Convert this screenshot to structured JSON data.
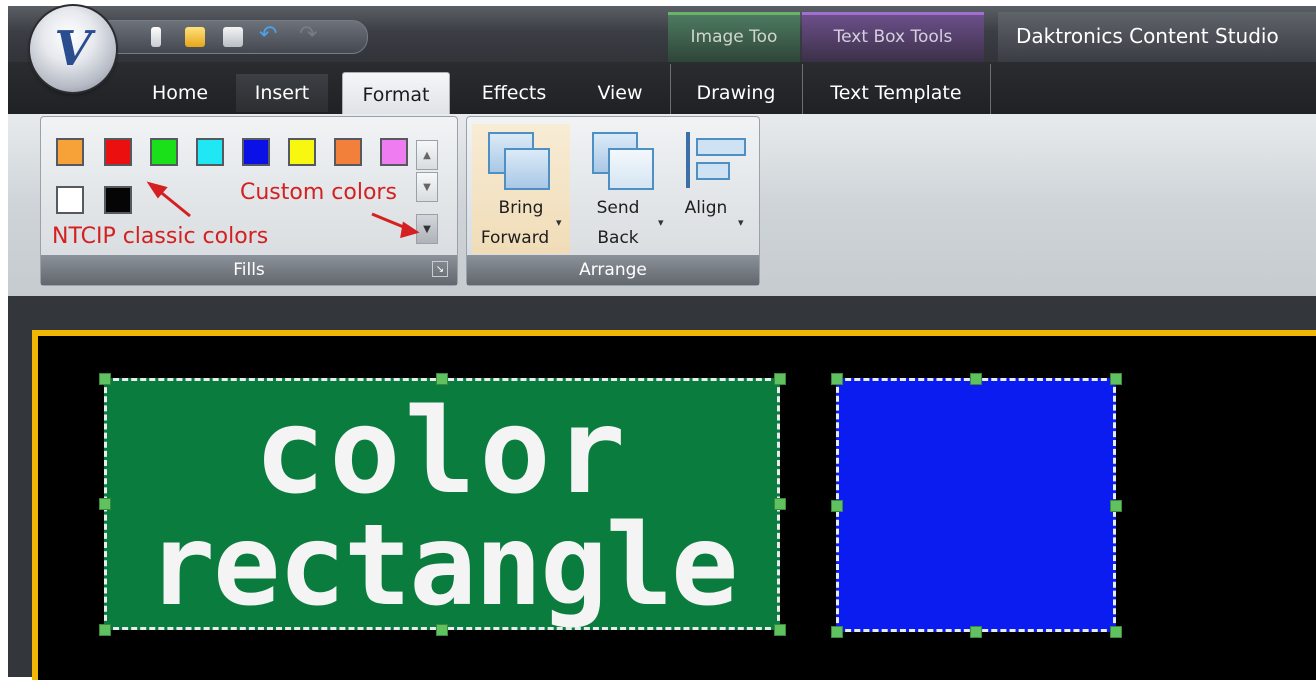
{
  "app": {
    "title": "Daktronics Content Studio",
    "logo_letter": "V",
    "contextual_tabs": [
      "Image Too",
      "Text Box Tools"
    ]
  },
  "quick_access": {
    "icons": [
      "new-document-icon",
      "open-folder-icon",
      "save-icon",
      "undo-icon",
      "redo-icon"
    ]
  },
  "tabs": [
    {
      "label": "Home"
    },
    {
      "label": "Insert"
    },
    {
      "label": "Format",
      "active": true
    },
    {
      "label": "Effects"
    },
    {
      "label": "View"
    },
    {
      "label": "Drawing"
    },
    {
      "label": "Text Template"
    }
  ],
  "fills": {
    "group_label": "Fills",
    "classic_colors": [
      "#f7a239",
      "#ec0f0f",
      "#19e019",
      "#1fe7f3",
      "#0a10e6",
      "#f7f710",
      "#ffffff",
      "#050505"
    ],
    "custom_colors": [
      "#f27f3a",
      "#ef7cf0"
    ],
    "annotation_custom": "Custom colors",
    "annotation_classic": "NTCIP classic colors"
  },
  "arrange": {
    "group_label": "Arrange",
    "bring_forward": {
      "line1": "Bring",
      "line2": "Forward"
    },
    "send_back": {
      "line1": "Send",
      "line2": "Back"
    },
    "align": "Align"
  },
  "canvas": {
    "text_line1": "color",
    "text_line2": "rectangle",
    "green_shape_color": "#0a7d3e",
    "blue_shape_color": "#0a1cf0",
    "sign_border_color": "#f2b705"
  }
}
